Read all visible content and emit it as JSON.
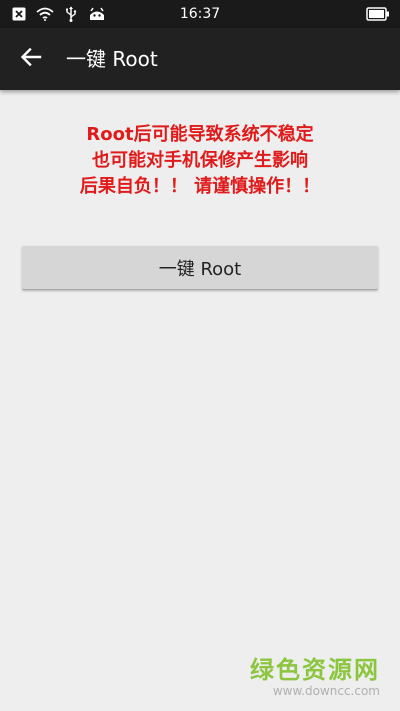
{
  "status_bar": {
    "time": "16:37",
    "icons": [
      "close-box-icon",
      "wifi-icon",
      "usb-icon",
      "android-icon",
      "battery-icon"
    ]
  },
  "app_bar": {
    "back_icon": "arrow-left-icon",
    "title": "一键 Root"
  },
  "warning": {
    "line1": "Root后可能导致系统不稳定",
    "line2": "也可能对手机保修产生影响",
    "line3": "后果自负！！ 请谨慎操作！！"
  },
  "main": {
    "root_button_label": "一键 Root"
  },
  "watermark": {
    "name": "绿色资源网",
    "url": "www.downcc.com"
  },
  "colors": {
    "status_bar_bg": "#1a1a1a",
    "app_bar_bg": "#212121",
    "page_bg": "#eeeeee",
    "warning_text": "#e01b1b",
    "button_bg": "#d6d6d6",
    "watermark_green": "#8cc63f"
  }
}
